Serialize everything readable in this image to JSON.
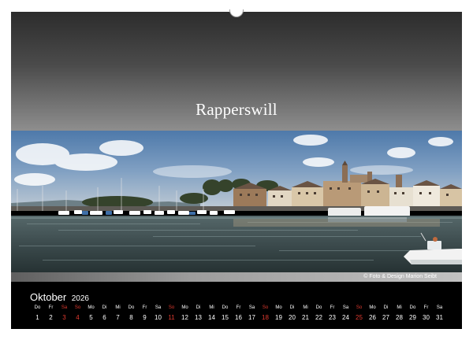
{
  "title": "Rapperswill",
  "photo": {
    "credit": "© Foto & Design Marion Seibt"
  },
  "calendar": {
    "month": "Oktober",
    "year": "2026",
    "holiday_color": "#e03a2f",
    "weekday_labels": [
      "Do",
      "Fr",
      "Sa",
      "So",
      "Mo",
      "Di",
      "Mi",
      "Do",
      "Fr",
      "Sa",
      "So",
      "Mo",
      "Di",
      "Mi",
      "Do",
      "Fr",
      "Sa",
      "So",
      "Mo",
      "Di",
      "Mi",
      "Do",
      "Fr",
      "Sa",
      "So",
      "Mo",
      "Di",
      "Mi",
      "Do",
      "Fr",
      "Sa"
    ],
    "day_numbers": [
      "1",
      "2",
      "3",
      "4",
      "5",
      "6",
      "7",
      "8",
      "9",
      "10",
      "11",
      "12",
      "13",
      "14",
      "15",
      "16",
      "17",
      "18",
      "19",
      "20",
      "21",
      "22",
      "23",
      "24",
      "25",
      "26",
      "27",
      "28",
      "29",
      "30",
      "31"
    ],
    "red_days": [
      "3",
      "4",
      "11",
      "18",
      "25"
    ]
  }
}
